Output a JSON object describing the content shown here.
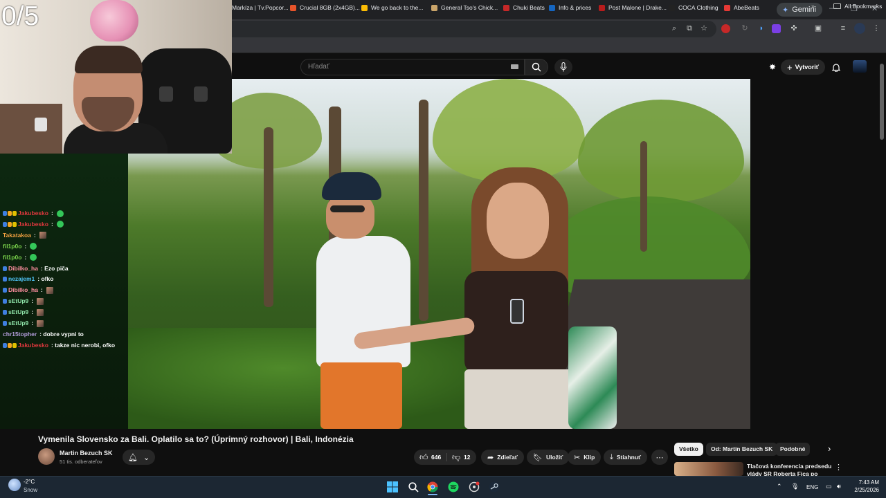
{
  "overlay": {
    "counter": "0/5"
  },
  "browser": {
    "gemini_label": "Gemini",
    "bookmarks": [
      {
        "label": "Markíza | Tv.Popcor...",
        "color": "#000000"
      },
      {
        "label": "Crucial 8GB (2x4GB)...",
        "color": "#e8542a"
      },
      {
        "label": "We go back to the...",
        "color": "#fbbc05"
      },
      {
        "label": "General Tso's Chick...",
        "color": "#c9a46a"
      },
      {
        "label": "Chuki Beats",
        "color": "#c62828"
      },
      {
        "label": "Info & prices",
        "color": "#1565c0"
      },
      {
        "label": "Post Malone | Drake...",
        "color": "#b71c1c"
      },
      {
        "label": "COCA Clothing",
        "color": "#222222"
      },
      {
        "label": "AbeBeats",
        "color": "#e53935"
      }
    ],
    "all_bookmarks": "All Bookmarks"
  },
  "youtube": {
    "search_placeholder": "Hľadať",
    "create_label": "Vytvoriť",
    "video_title": "Vymenila Slovensko za Bali. Oplatilo sa to? (Úprimný rozhovor) | Bali, Indonézia",
    "channel_name": "Martin Bezuch SK",
    "subscribers": "51 tis. odberateľov",
    "likes": "646",
    "dislikes": "12",
    "share": "Zdieľať",
    "save": "Uložiť",
    "clip": "Klip",
    "download": "Stiahnuť",
    "chips": [
      "Všetko",
      "Od: Martin Bezuch SK",
      "Podobné"
    ],
    "reco_title": "Tlačová konferencia predsedu vlády SR Roberta Fica po"
  },
  "chat": [
    {
      "user": "Jakubesko",
      "color": "#e0383e",
      "msg": ":",
      "emote": "green"
    },
    {
      "user": "Jakubesko",
      "color": "#e0383e",
      "msg": ":",
      "emote": "green"
    },
    {
      "user": "Takatakoa",
      "color": "#f0a040",
      "msg": ":",
      "emote": "img"
    },
    {
      "user": "fil1p0o",
      "color": "#7ad34b",
      "msg": ":",
      "emote": "green"
    },
    {
      "user": "fil1p0o",
      "color": "#7ad34b",
      "msg": ":",
      "emote": "green"
    },
    {
      "user": "Dibilko_ha",
      "color": "#ff8fa0",
      "msg": ": Ezo piča",
      "emote": ""
    },
    {
      "user": "nezajem1",
      "color": "#4fc3f7",
      "msg": ": ofko",
      "emote": ""
    },
    {
      "user": "Dibilko_ha",
      "color": "#ff8fa0",
      "msg": ":",
      "emote": "img"
    },
    {
      "user": "sEtUp9",
      "color": "#8fe3a8",
      "msg": ":",
      "emote": "img"
    },
    {
      "user": "sEtUp9",
      "color": "#8fe3a8",
      "msg": ":",
      "emote": "img"
    },
    {
      "user": "sEtUp9",
      "color": "#8fe3a8",
      "msg": ":",
      "emote": "img"
    },
    {
      "user": "chr15topher",
      "color": "#b39ddb",
      "msg": ": dobre vypni to",
      "emote": ""
    },
    {
      "user": "Jakubesko",
      "color": "#e0383e",
      "msg": ": takze nic nerobi, ofko",
      "emote": ""
    }
  ],
  "taskbar": {
    "temperature": "-2°C",
    "weather": "Snow",
    "language": "ENG",
    "time": "7:43 AM",
    "date": "2/25/2026"
  }
}
